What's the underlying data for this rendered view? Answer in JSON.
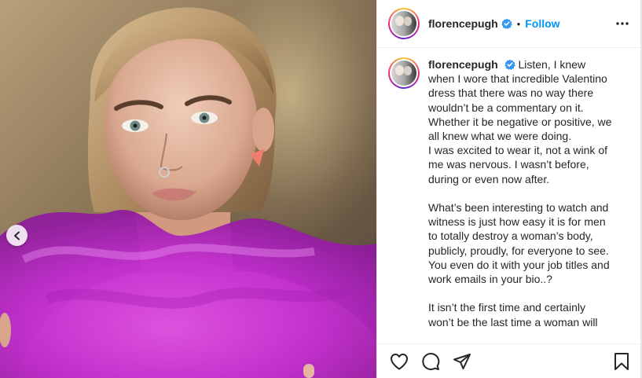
{
  "header": {
    "username": "florencepugh",
    "separator": "•",
    "follow_label": "Follow"
  },
  "caption": {
    "username": "florencepugh",
    "text": "Listen, I knew when I wore that incredible Valentino dress that there was no way there wouldn’t be a commentary on it. Whether it be negative or positive, we all knew what we were doing.\nI was excited to wear it, not a wink of me was nervous. I wasn’t before, during or even now after.\n\nWhat’s been interesting to watch and witness is just how easy it is for men to totally destroy a woman’s body, publicly, proudly, for everyone to see. You even do it with your job titles and work emails in your bio..?\n\nIt isn’t the first time and certainly won’t be the last time a woman will"
  },
  "icons": {
    "verified": "verified-badge-icon",
    "more": "more-options-icon",
    "prev": "chevron-left-icon",
    "like": "heart-icon",
    "comment": "comment-icon",
    "share": "paper-plane-icon",
    "save": "bookmark-icon"
  },
  "colors": {
    "accent": "#0095f6",
    "dress": "#c72ad8"
  }
}
